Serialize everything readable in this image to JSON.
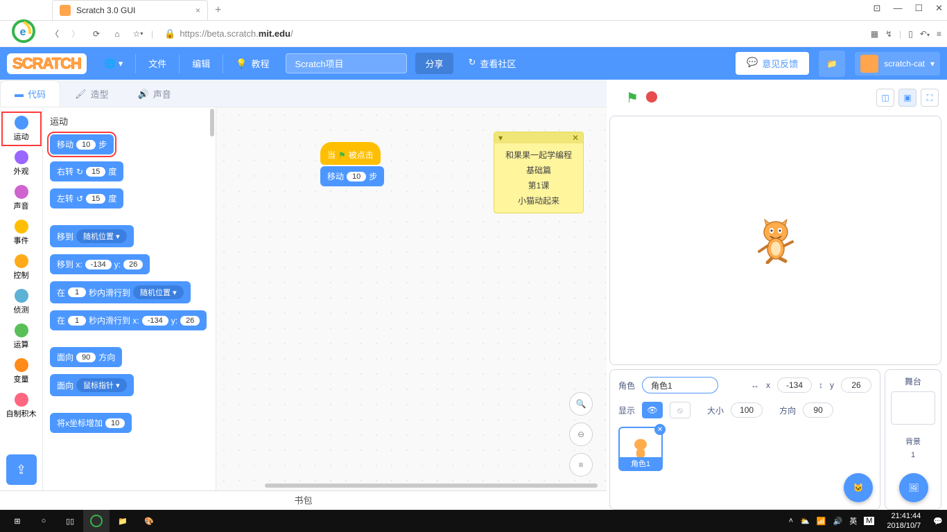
{
  "browser": {
    "tab_title": "Scratch 3.0 GUI",
    "url_prefix": "https://beta.scratch.",
    "url_host": "mit.edu",
    "url_suffix": "/"
  },
  "menubar": {
    "logo": "SCRATCH",
    "file": "文件",
    "edit": "编辑",
    "tutorials": "教程",
    "project_name": "Scratch项目",
    "share": "分享",
    "community": "查看社区",
    "feedback": "意见反馈",
    "username": "scratch-cat"
  },
  "tabs": {
    "code": "代码",
    "costumes": "造型",
    "sounds": "声音"
  },
  "categories": {
    "motion": "运动",
    "looks": "外观",
    "sound": "声音",
    "events": "事件",
    "control": "控制",
    "sensing": "侦测",
    "operators": "运算",
    "variables": "变量",
    "myblocks": "自制积木"
  },
  "cat_colors": {
    "motion": "#4c97ff",
    "looks": "#9966ff",
    "sound": "#cf63cf",
    "events": "#ffbf00",
    "control": "#ffab19",
    "sensing": "#5cb1d6",
    "operators": "#59c059",
    "variables": "#ff8c1a",
    "myblocks": "#ff6680"
  },
  "palette": {
    "title": "运动",
    "move_a": "移动",
    "move_val": "10",
    "move_b": "步",
    "turnr_a": "右转",
    "turnr_val": "15",
    "turnr_b": "度",
    "turnl_a": "左转",
    "turnl_val": "15",
    "turnl_b": "度",
    "goto_a": "移到",
    "goto_drop": "随机位置 ▾",
    "gotoxy_a": "移到 x:",
    "gotoxy_x": "-134",
    "gotoxy_b": "y:",
    "gotoxy_y": "26",
    "glide_a": "在",
    "glide_secs": "1",
    "glide_b": "秒内滑行到",
    "glide_drop": "随机位置 ▾",
    "glidexy_a": "在",
    "glidexy_secs": "1",
    "glidexy_b": "秒内滑行到 x:",
    "glidexy_x": "-134",
    "glidexy_y": "26",
    "glidexy_c": "y:",
    "point_a": "面向",
    "point_val": "90",
    "point_b": "方向",
    "pointto_a": "面向",
    "pointto_drop": "鼠标指针 ▾",
    "changex_a": "将x坐标增加",
    "changex_val": "10"
  },
  "workspace": {
    "hat_a": "当",
    "hat_b": "被点击",
    "move_a": "移动",
    "move_val": "10",
    "move_b": "步"
  },
  "comment": {
    "line1": "和果果一起学编程",
    "line2": "基础篇",
    "line3": "第1课",
    "line4": "小猫动起来"
  },
  "sprite_info": {
    "label_sprite": "角色",
    "sprite_name": "角色1",
    "x_label": "x",
    "x": "-134",
    "y_label": "y",
    "y": "26",
    "show_label": "显示",
    "size_label": "大小",
    "size": "100",
    "dir_label": "方向",
    "dir": "90",
    "tile_label": "角色1",
    "stage_label": "舞台",
    "backdrop_label": "背景",
    "backdrop_count": "1"
  },
  "backpack": "书包",
  "taskbar": {
    "ime1": "英",
    "ime2": "M",
    "time": "21:41:44",
    "date": "2018/10/7"
  }
}
